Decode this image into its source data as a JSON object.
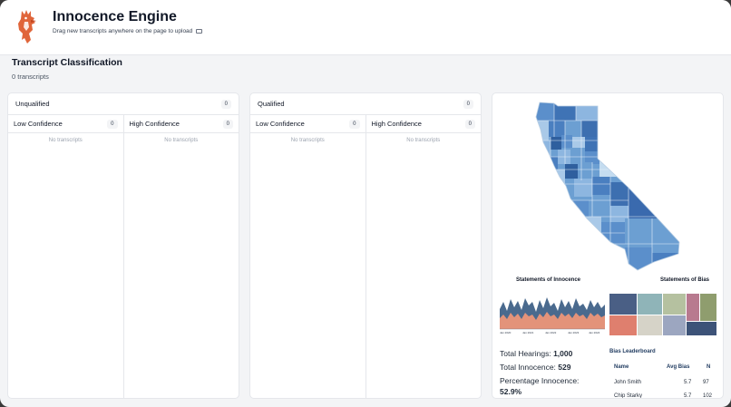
{
  "header": {
    "title": "Innocence Engine",
    "upload_hint": "Drag new transcripts anywhere on the page to upload"
  },
  "classification": {
    "title": "Transcript Classification",
    "count": "0 transcripts"
  },
  "panels": [
    {
      "label": "Unqualified",
      "count": "0",
      "columns": [
        {
          "label": "Low Confidence",
          "count": "0",
          "empty": "No transcripts"
        },
        {
          "label": "High Confidence",
          "count": "0",
          "empty": "No transcripts"
        }
      ]
    },
    {
      "label": "Qualified",
      "count": "0",
      "columns": [
        {
          "label": "Low Confidence",
          "count": "0",
          "empty": "No transcripts"
        },
        {
          "label": "High Confidence",
          "count": "0",
          "empty": "No transcripts"
        }
      ]
    }
  ],
  "viz": {
    "innocence_chart_title": "Statements of Innocence",
    "bias_chart_title": "Statements of Bias",
    "x_ticks": [
      "Jan 2020",
      "Jan 2021",
      "Jan 2022",
      "Jan 2023",
      "Jan 2024"
    ],
    "stats": {
      "total_hearings_label": "Total Hearings:",
      "total_hearings_value": "1,000",
      "total_innocence_label": "Total Innocence:",
      "total_innocence_value": "529",
      "percentage_label": "Percentage Innocence:",
      "percentage_value": "52.9%"
    },
    "leaderboard": {
      "title": "Bias Leaderboard",
      "headers": {
        "name": "Name",
        "avg": "Avg Bias",
        "n": "N"
      },
      "rows": [
        {
          "name": "John Smith",
          "avg": "5.7",
          "n": "97"
        },
        {
          "name": "Chip Starky",
          "avg": "5.7",
          "n": "102"
        }
      ]
    },
    "colors": {
      "map_dark": "#3d6fb0",
      "map_mid": "#6c9fd2",
      "map_light": "#a9c9e8",
      "area_upper": "#4a6a8e",
      "area_lower": "#e3937a"
    }
  }
}
